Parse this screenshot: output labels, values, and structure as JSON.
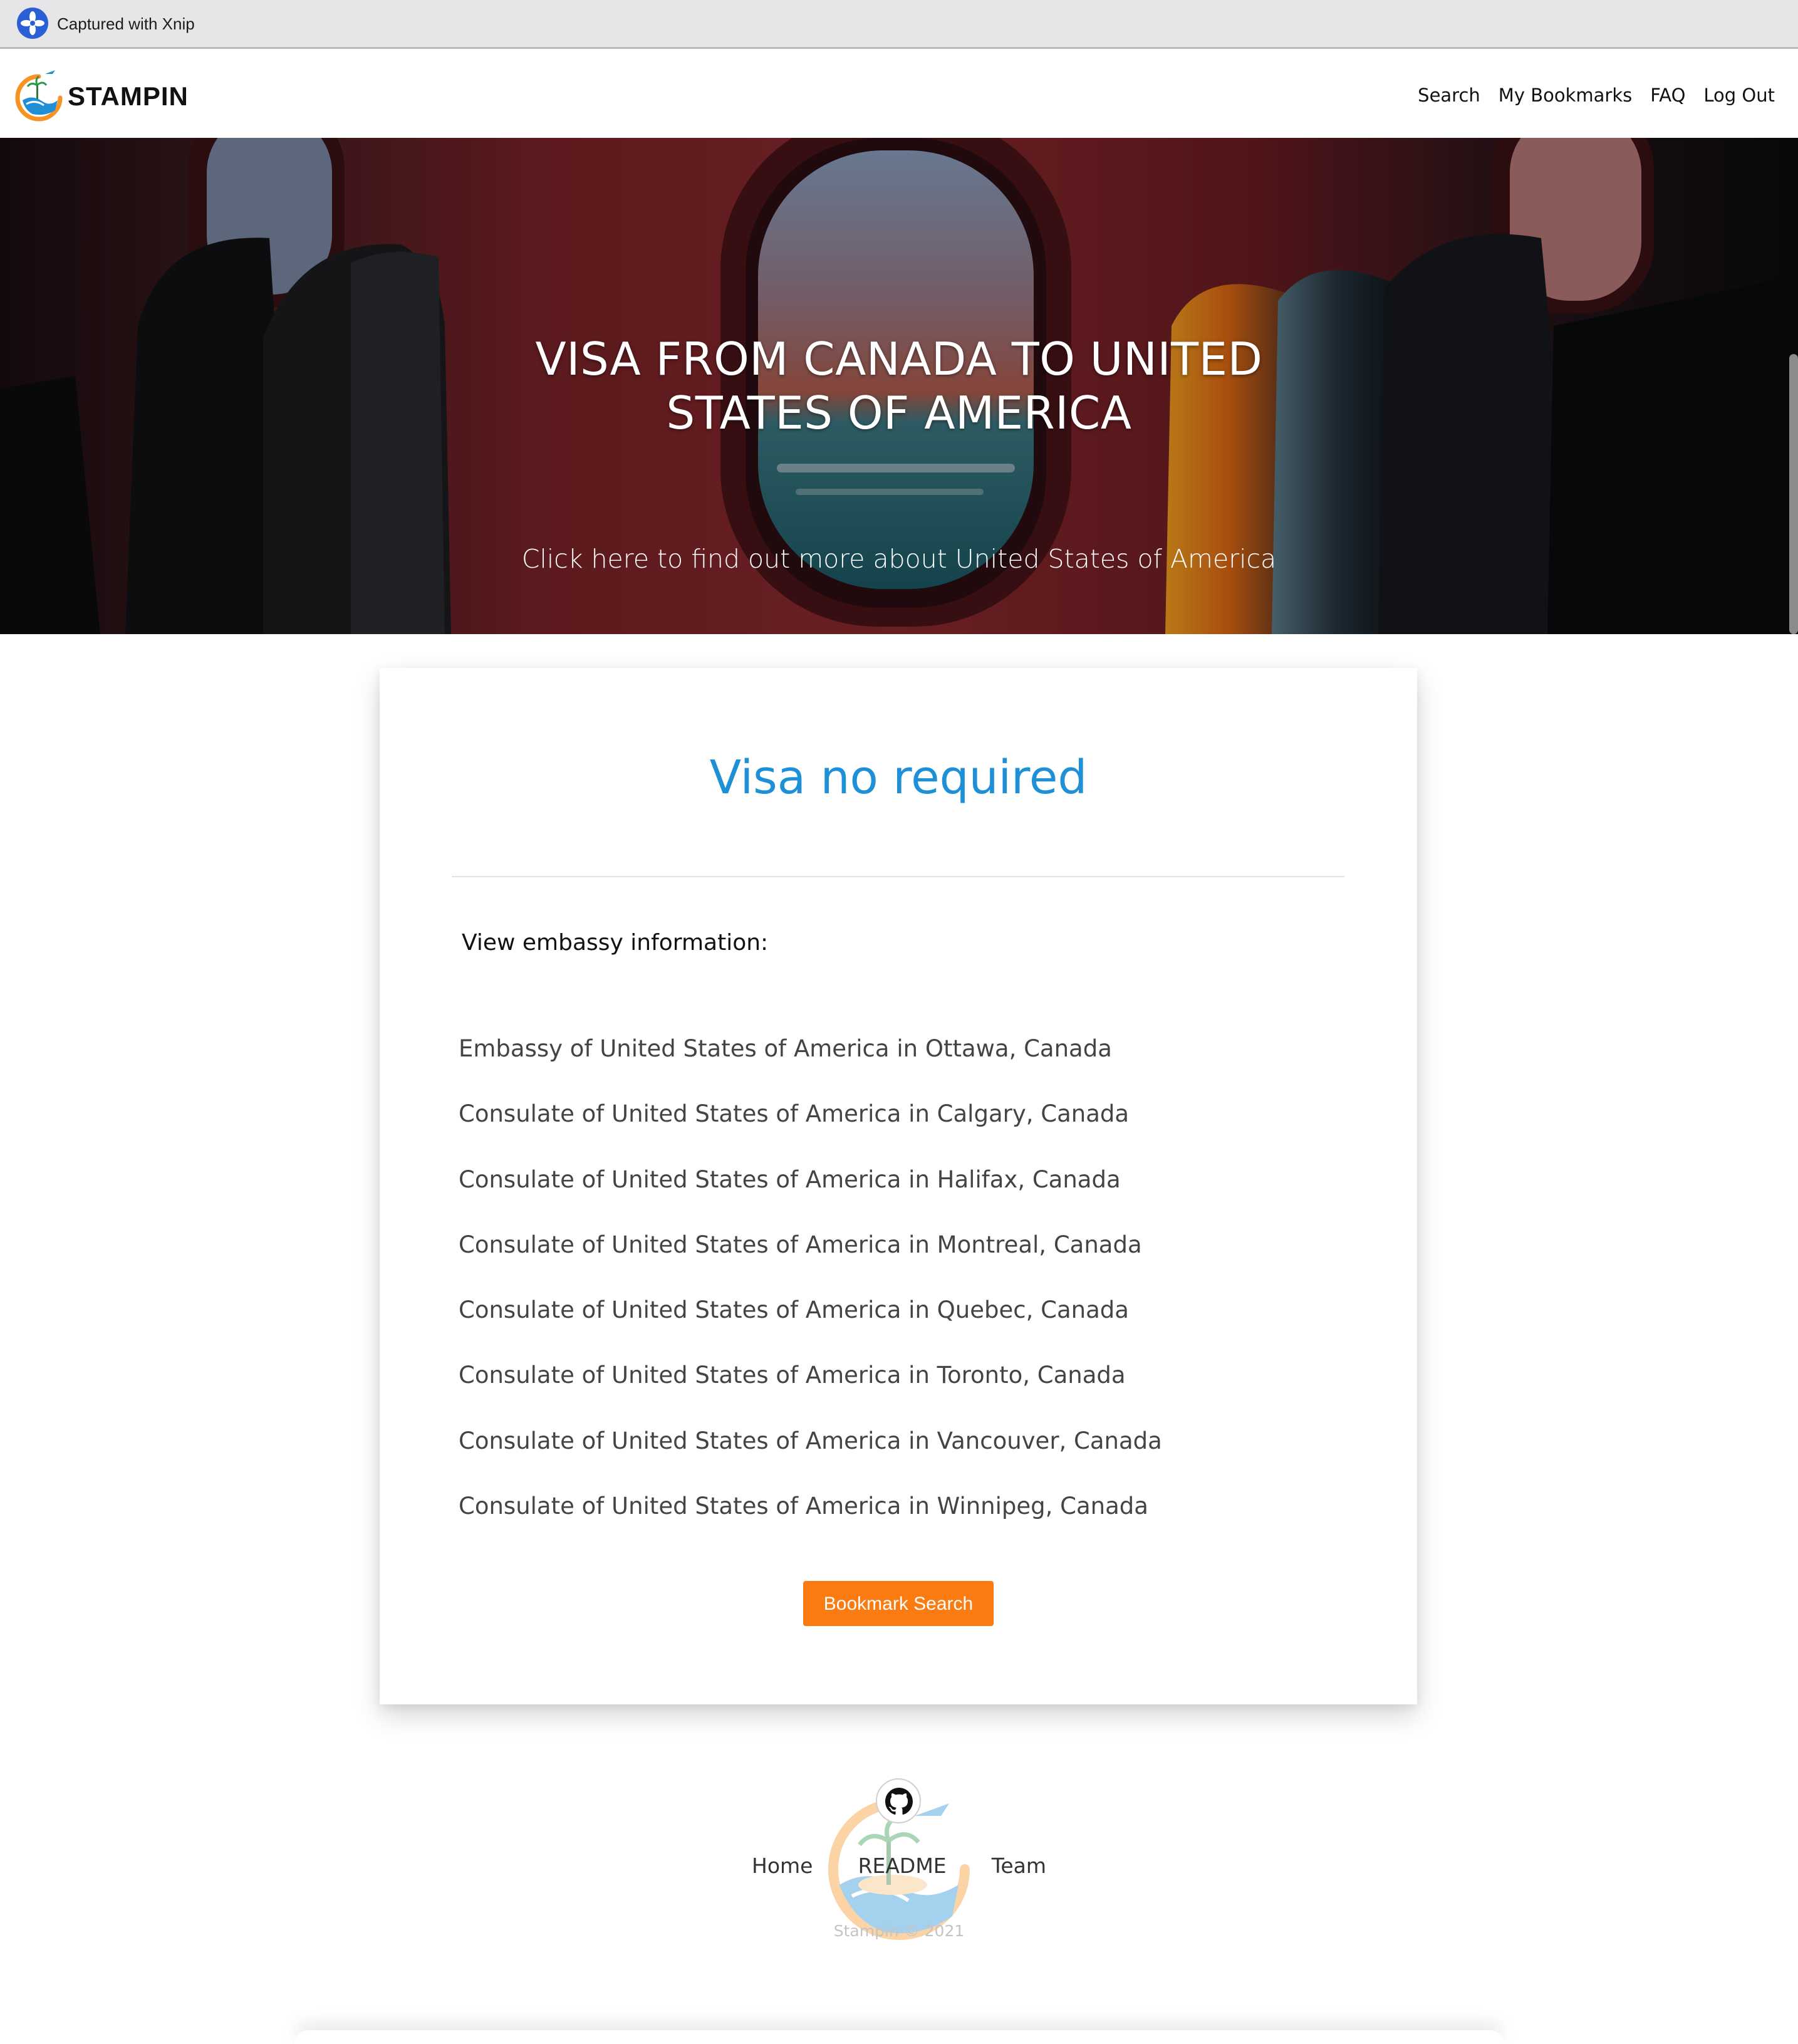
{
  "capture_bar": {
    "text": "Captured with Xnip",
    "icon": "xnip-icon"
  },
  "navbar": {
    "brand": "STAMPIN",
    "links": [
      "Search",
      "My Bookmarks",
      "FAQ",
      "Log Out"
    ]
  },
  "hero": {
    "title_line1": "VISA FROM CANADA TO UNITED",
    "title_line2": "STATES OF AMERICA",
    "link_text": "Click here to find out more about United States of America"
  },
  "result": {
    "status": "Visa no required",
    "status_color": "#1e90d8",
    "embassy_heading": "View embassy information:",
    "embassies": [
      "Embassy of United States of America in Ottawa, Canada",
      "Consulate of United States of America in Calgary, Canada",
      "Consulate of United States of America in Halifax, Canada",
      "Consulate of United States of America in Montreal, Canada",
      "Consulate of United States of America in Quebec, Canada",
      "Consulate of United States of America in Toronto, Canada",
      "Consulate of United States of America in Vancouver, Canada",
      "Consulate of United States of America in Winnipeg, Canada"
    ],
    "bookmark_button": "Bookmark Search",
    "button_color": "#fb7b10"
  },
  "footer": {
    "links": [
      "Home",
      "README",
      "Team"
    ],
    "copyright": "Stampin © 2021",
    "icon": "github-icon"
  }
}
